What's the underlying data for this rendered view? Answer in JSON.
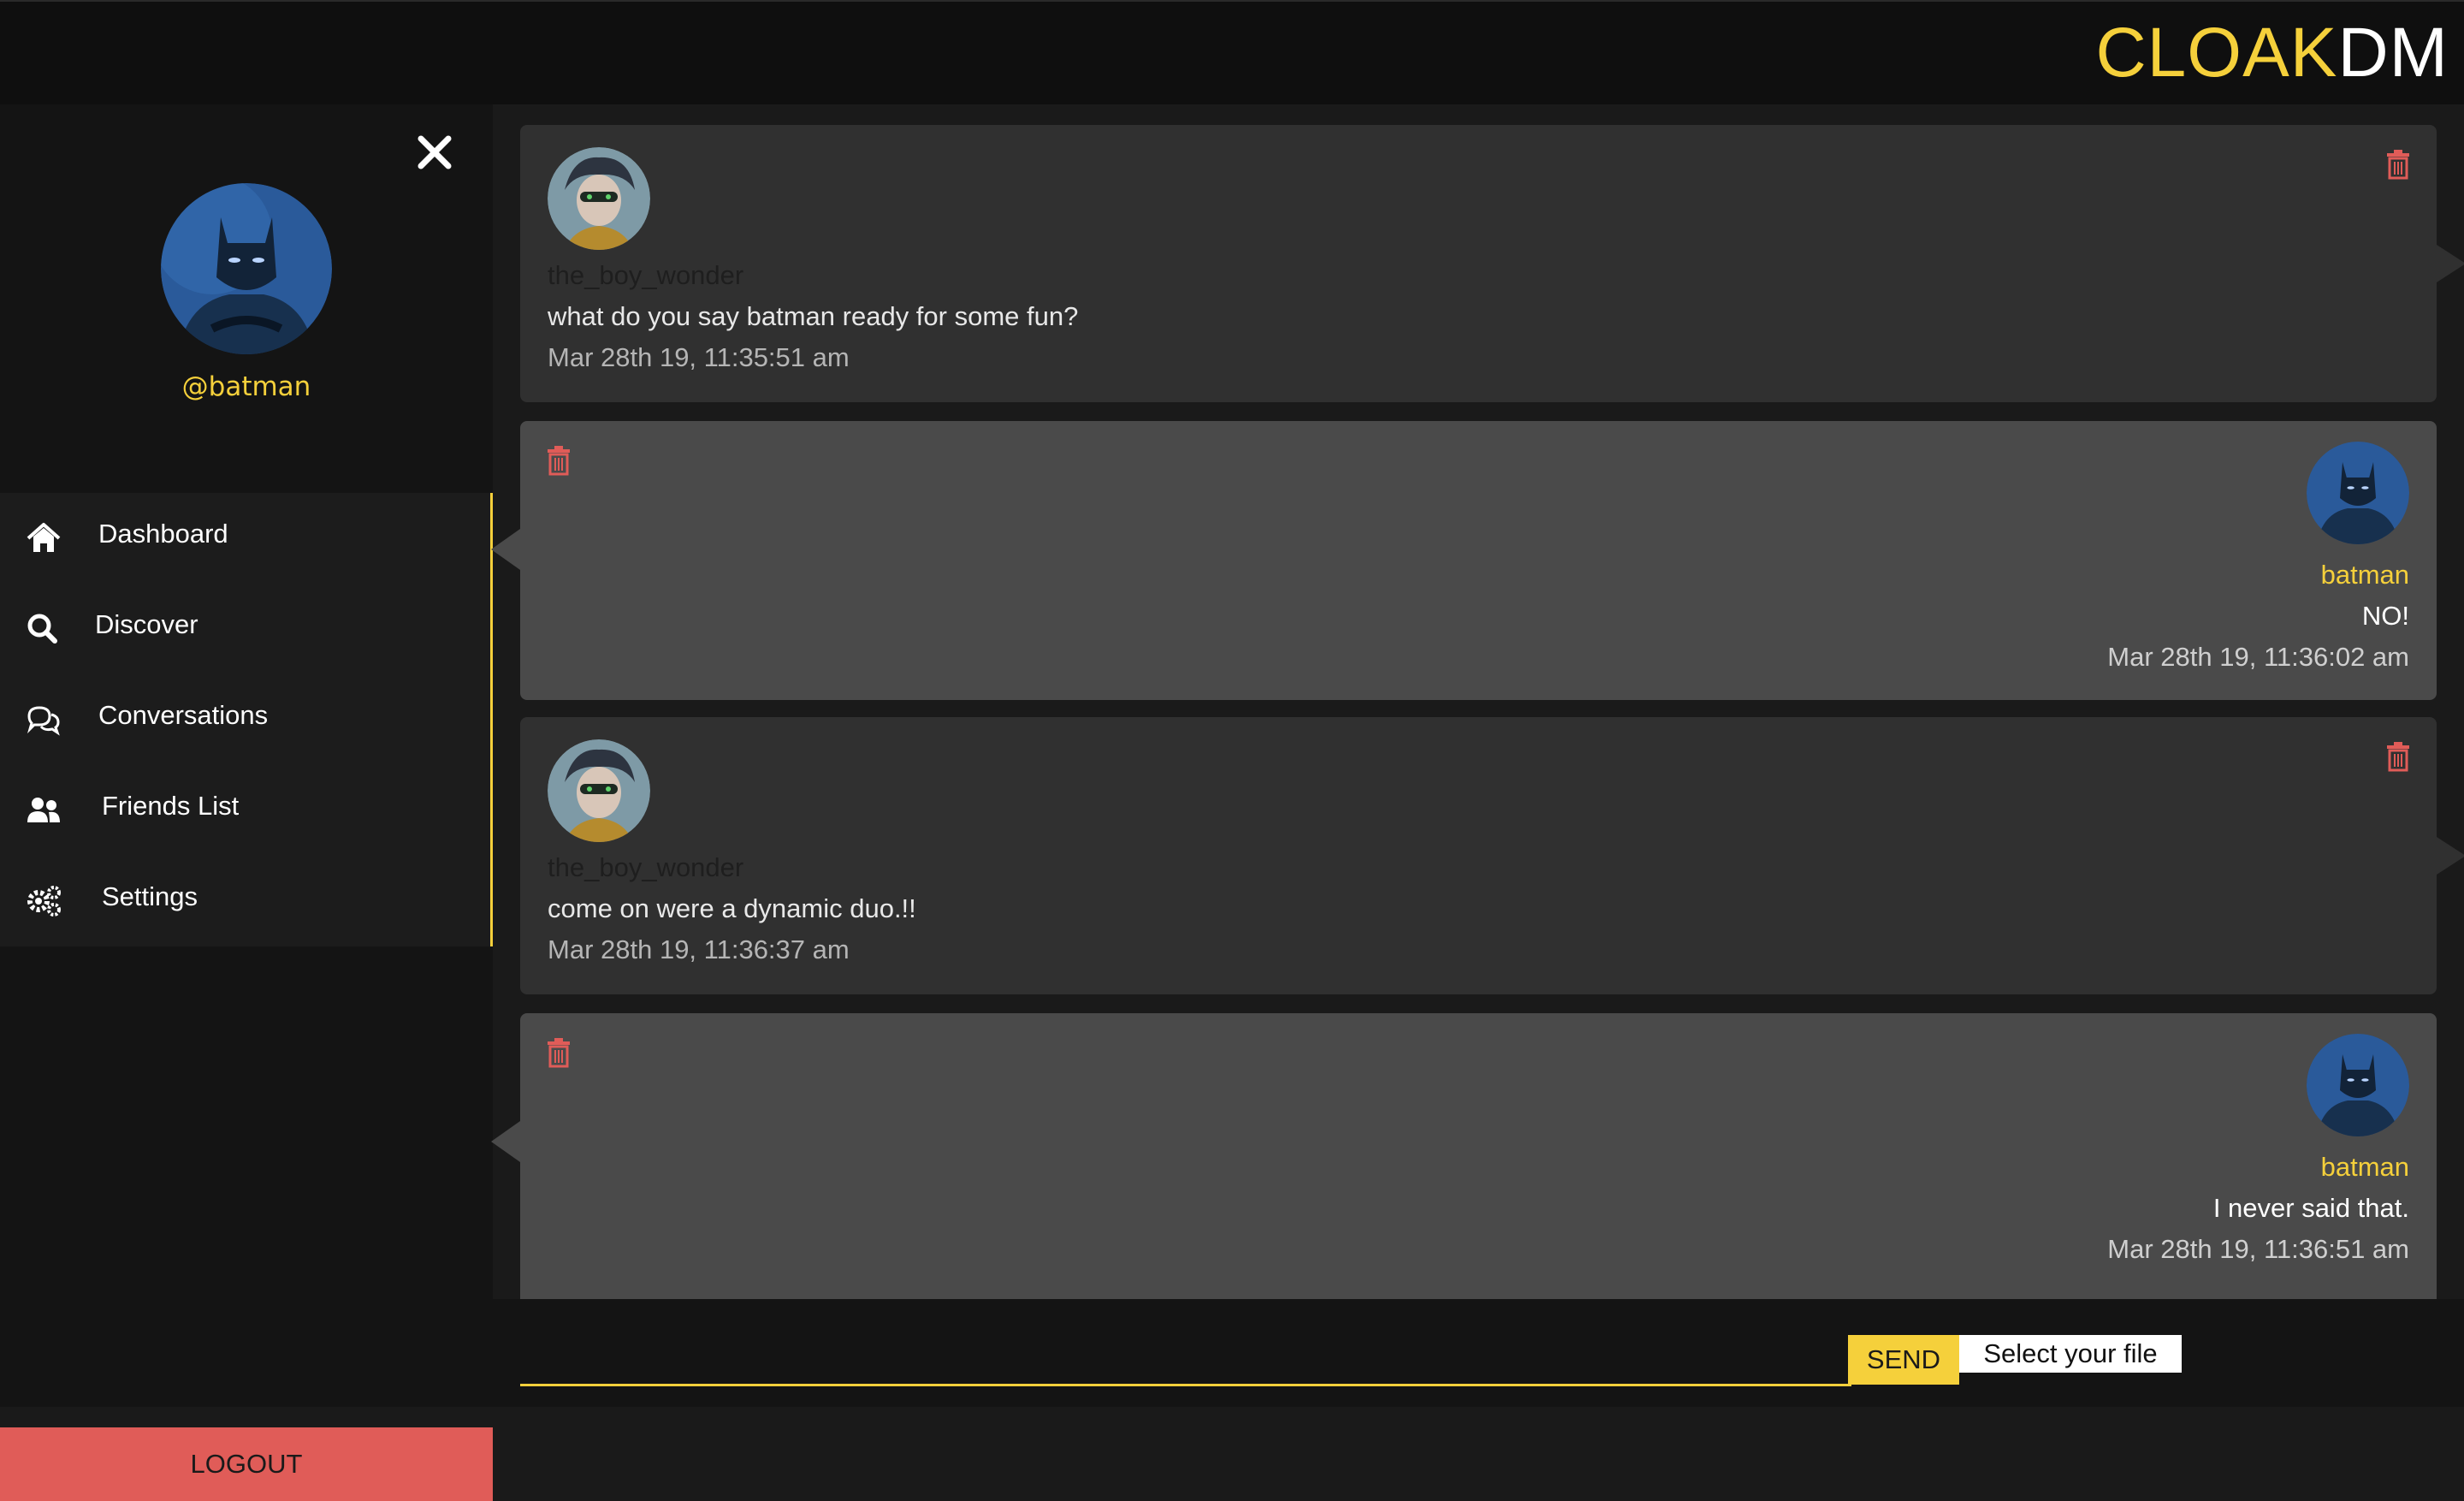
{
  "brand": {
    "part1": "CLOAK",
    "part2": "DM",
    "accent": "#f5d03b"
  },
  "sidebar": {
    "close_icon": "close-icon",
    "handle": "@batman",
    "items": [
      {
        "label": "Dashboard",
        "icon": "home-icon"
      },
      {
        "label": "Discover",
        "icon": "search-icon"
      },
      {
        "label": "Conversations",
        "icon": "chat-bubbles-icon"
      },
      {
        "label": "Friends List",
        "icon": "users-icon"
      },
      {
        "label": "Settings",
        "icon": "gears-icon"
      }
    ],
    "logout": "LOGOUT"
  },
  "messages": [
    {
      "sender": "the_boy_wonder",
      "text": "what do you say batman ready for some fun?",
      "time": "Mar 28th 19, 11:35:51 am",
      "mine": false
    },
    {
      "sender": "batman",
      "text": "NO!",
      "time": "Mar 28th 19, 11:36:02 am",
      "mine": true
    },
    {
      "sender": "the_boy_wonder",
      "text": "come on were a dynamic duo.!!",
      "time": "Mar 28th 19, 11:36:37 am",
      "mine": false
    },
    {
      "sender": "batman",
      "text": "I never said that.",
      "time": "Mar 28th 19, 11:36:51 am",
      "mine": true
    }
  ],
  "composer": {
    "send_label": "SEND",
    "file_label": "Select your file",
    "input_value": ""
  },
  "colors": {
    "delete": "#e05c58",
    "logout_bg": "#e05c58"
  }
}
